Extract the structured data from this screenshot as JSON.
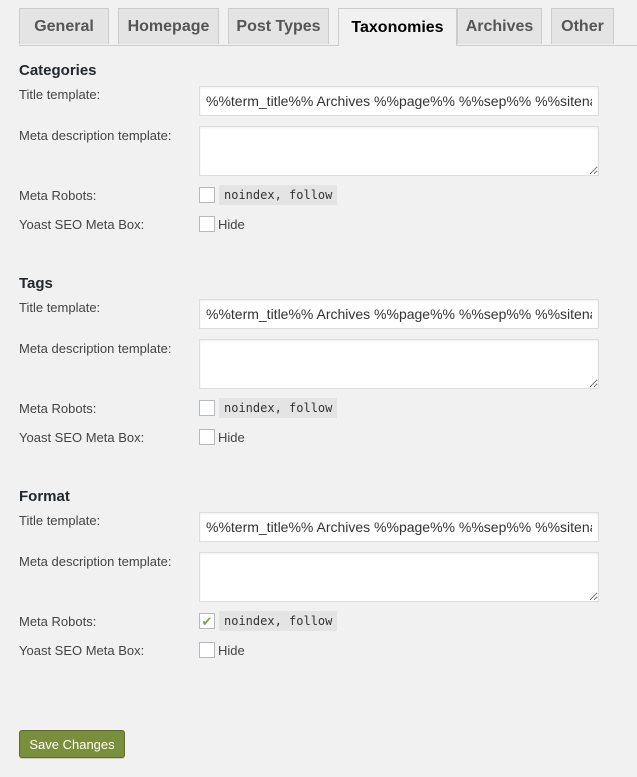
{
  "tabs": [
    {
      "label": "General",
      "active": false
    },
    {
      "label": "Homepage",
      "active": false
    },
    {
      "label": "Post Types",
      "active": false
    },
    {
      "label": "Taxonomies",
      "active": true
    },
    {
      "label": "Archives",
      "active": false
    },
    {
      "label": "Other",
      "active": false
    }
  ],
  "labels": {
    "title_template": "Title template:",
    "meta_description": "Meta description template:",
    "meta_robots": "Meta Robots:",
    "meta_box": "Yoast SEO Meta Box:",
    "noindex": "noindex, follow",
    "hide": "Hide"
  },
  "sections": [
    {
      "heading": "Categories",
      "title_template": "%%term_title%% Archives %%page%% %%sep%% %%sitename%%",
      "meta_description": "",
      "noindex_checked": false,
      "hide_checked": false
    },
    {
      "heading": "Tags",
      "title_template": "%%term_title%% Archives %%page%% %%sep%% %%sitename%%",
      "meta_description": "",
      "noindex_checked": false,
      "hide_checked": false
    },
    {
      "heading": "Format",
      "title_template": "%%term_title%% Archives %%page%% %%sep%% %%sitename%%",
      "meta_description": "",
      "noindex_checked": true,
      "hide_checked": false
    }
  ],
  "save_label": "Save Changes",
  "colors": {
    "accent": "#7a8f3b",
    "check": "#7ea13e"
  }
}
